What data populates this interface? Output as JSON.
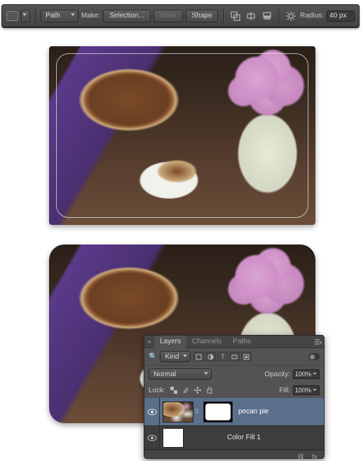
{
  "options_bar": {
    "mode_label": "Path",
    "make_label": "Make:",
    "selection_button": "Selection...",
    "mask_button": "Mask",
    "shape_button": "Shape",
    "radius_label": "Radius:",
    "radius_value": "40 px"
  },
  "layers_panel": {
    "tabs": [
      "Layers",
      "Channels",
      "Paths"
    ],
    "filter_label": "Kind",
    "blend_mode": "Normal",
    "opacity_label": "Opacity:",
    "opacity_value": "100%",
    "lock_label": "Lock:",
    "fill_label": "Fill:",
    "fill_value": "100%",
    "layers": [
      {
        "name": "pecan pie",
        "visible": true,
        "selected": true,
        "has_mask": true
      },
      {
        "name": "Color Fill 1",
        "visible": true,
        "selected": false,
        "has_mask": false
      }
    ]
  }
}
